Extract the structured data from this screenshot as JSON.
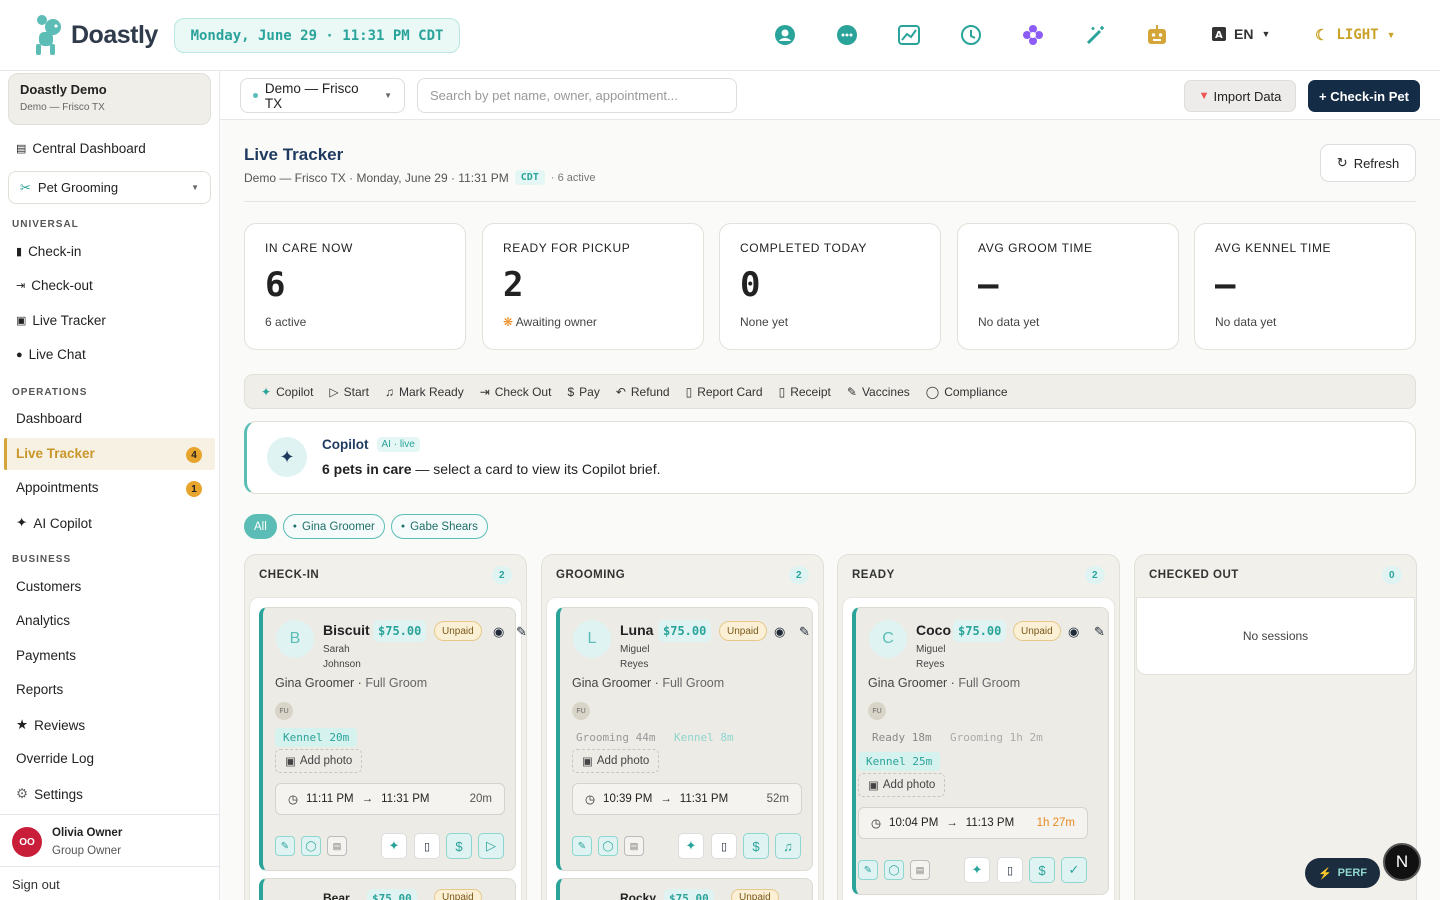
{
  "app": {
    "name": "Doastly",
    "datetime": "Monday, June 29 · 11:31 PM CDT"
  },
  "topbar": {
    "icons": [
      "support-icon",
      "chat-icon",
      "chart-icon",
      "clock-icon",
      "flower-icon",
      "magic-wand-icon",
      "robot-icon"
    ],
    "lang": "EN",
    "theme": "LIGHT"
  },
  "sidebar": {
    "org_name": "Doastly Demo",
    "org_sub": "Demo — Frisco TX",
    "central": "Central Dashboard",
    "module": "Pet Grooming",
    "sec_universal": "UNIVERSAL",
    "checkin": "Check-in",
    "checkout": "Check-out",
    "livetracker": "Live Tracker",
    "livechat": "Live Chat",
    "sec_operations": "OPERATIONS",
    "dashboard": "Dashboard",
    "live_tracker": "Live Tracker",
    "live_tracker_badge": "4",
    "appointments": "Appointments",
    "appointments_badge": "1",
    "ai_copilot": "AI Copilot",
    "sec_business": "BUSINESS",
    "customers": "Customers",
    "analytics": "Analytics",
    "payments": "Payments",
    "reports": "Reports",
    "reviews": "Reviews",
    "override_log": "Override Log",
    "settings": "Settings",
    "user_initials": "OO",
    "user_name": "Olivia Owner",
    "user_role": "Group Owner",
    "signout": "Sign out"
  },
  "header": {
    "location": "Demo — Frisco TX",
    "search_placeholder": "Search by pet name, owner, appointment...",
    "import": "Import Data",
    "checkin_pet": "+ Check-in Pet"
  },
  "page": {
    "title": "Live Tracker",
    "subtitle": "Demo — Frisco TX · Monday, June 29 · 11:31 PM",
    "tz": "CDT",
    "active": "· 6 active",
    "refresh": "Refresh"
  },
  "stats": [
    {
      "label": "IN CARE NOW",
      "value": "6",
      "caption": "6 active"
    },
    {
      "label": "READY FOR PICKUP",
      "value": "2",
      "caption": "Awaiting owner"
    },
    {
      "label": "COMPLETED TODAY",
      "value": "0",
      "caption": "None yet"
    },
    {
      "label": "AVG GROOM TIME",
      "value": "—",
      "caption": "No data yet"
    },
    {
      "label": "AVG KENNEL TIME",
      "value": "—",
      "caption": "No data yet"
    }
  ],
  "actions": [
    "Copilot",
    "Start",
    "Mark Ready",
    "Check Out",
    "Pay",
    "Refund",
    "Report Card",
    "Receipt",
    "Vaccines",
    "Compliance"
  ],
  "copilot": {
    "title": "Copilot",
    "tag": "AI · live",
    "bold": "6 pets in care",
    "rest": " — select a card to view its Copilot brief."
  },
  "filters": {
    "all": "All",
    "g1": "Gina Groomer",
    "g2": "Gabe Shears"
  },
  "columns": [
    {
      "title": "CHECK-IN",
      "count": "2"
    },
    {
      "title": "GROOMING",
      "count": "2"
    },
    {
      "title": "READY",
      "count": "2"
    },
    {
      "title": "CHECKED OUT",
      "count": "0"
    }
  ],
  "no_sessions": "No sessions",
  "cards": [
    {
      "initial": "B",
      "name": "Biscuit",
      "price": "$75.00",
      "status": "Unpaid",
      "owner": "Sarah Johnson",
      "groomer": "Gina Groomer",
      "service": "Full Groom",
      "fu": "FU",
      "tags": [
        "Kennel 20m"
      ],
      "photo": "Add photo",
      "start": "11:11 PM",
      "end": "11:31 PM",
      "duration": "20m"
    },
    {
      "initial": "L",
      "name": "Luna",
      "price": "$75.00",
      "status": "Unpaid",
      "owner": "Miguel Reyes",
      "groomer": "Gina Groomer",
      "service": "Full Groom",
      "fu": "FU",
      "tags": [
        "Grooming 44m",
        "Kennel 8m"
      ],
      "photo": "Add photo",
      "start": "10:39 PM",
      "end": "11:31 PM",
      "duration": "52m"
    },
    {
      "initial": "C",
      "name": "Coco",
      "price": "$75.00",
      "status": "Unpaid",
      "owner": "Miguel Reyes",
      "groomer": "Gina Groomer",
      "service": "Full Groom",
      "fu": "FU",
      "tags": [
        "Ready 18m",
        "Grooming 1h 2m",
        "Kennel 25m"
      ],
      "photo": "Add photo",
      "start": "10:04 PM",
      "end": "11:13 PM",
      "duration": "1h 27m"
    }
  ],
  "peek": [
    {
      "name": "Bear",
      "price": "$75.00",
      "status": "Unpaid"
    },
    {
      "name": "Rocky",
      "price": "$75.00",
      "status": "Unpaid"
    }
  ],
  "perf": "PERF",
  "fab": "N",
  "colors": {
    "teal": "#2aa39a",
    "navy": "#142c45",
    "gold": "#d4a63a",
    "danger": "#c81e3a",
    "warn": "#e8891c"
  }
}
